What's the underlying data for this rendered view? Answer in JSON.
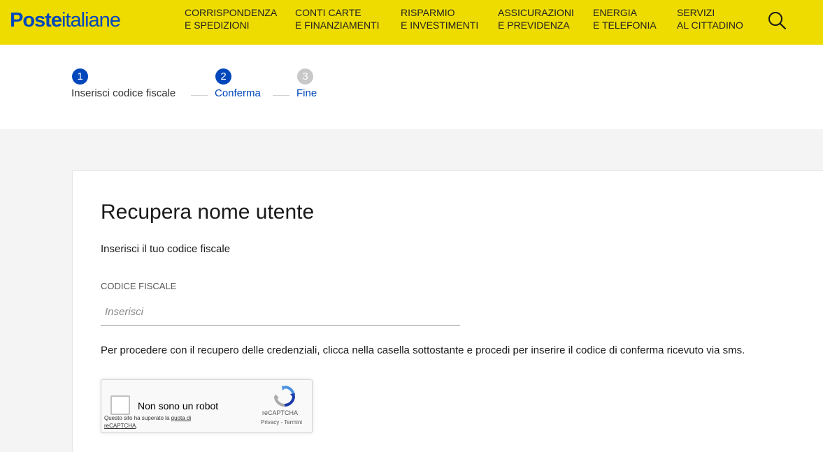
{
  "header": {
    "logo_bold": "Poste",
    "logo_light": "italiane",
    "nav": [
      {
        "line1": "CORRISPONDENZA",
        "line2": "E SPEDIZIONI"
      },
      {
        "line1": "CONTI CARTE",
        "line2": "E FINANZIAMENTI"
      },
      {
        "line1": "RISPARMIO",
        "line2": "E INVESTIMENTI"
      },
      {
        "line1": "ASSICURAZIONI",
        "line2": "E PREVIDENZA"
      },
      {
        "line1": "ENERGIA",
        "line2": "E TELEFONIA"
      },
      {
        "line1": "SERVIZI",
        "line2": "AL CITTADINO"
      }
    ],
    "search_icon": "search-icon"
  },
  "stepper": {
    "steps": [
      {
        "number": "1",
        "label": "Inserisci codice fiscale",
        "state": "completed"
      },
      {
        "number": "2",
        "label": "Conferma",
        "state": "active"
      },
      {
        "number": "3",
        "label": "Fine",
        "state": "pending"
      }
    ]
  },
  "form": {
    "title": "Recupera nome utente",
    "subtitle": "Inserisci il tuo codice fiscale",
    "field_label": "CODICE FISCALE",
    "field_placeholder": "Inserisci",
    "field_value": "",
    "instructions": "Per procedere con il recupero delle credenziali, clicca nella casella sottostante e procedi per inserire il codice di conferma ricevuto via sms."
  },
  "captcha": {
    "label": "Non sono un robot",
    "note_prefix": "Questo sito ha superato la ",
    "note_link": "quota di reCAPTCHA",
    "note_suffix": ".",
    "brand": "reCAPTCHA",
    "terms": "Privacy - Termini"
  },
  "colors": {
    "header_bg": "#eedc00",
    "brand_blue": "#0047bb",
    "step_pending": "#c8c8c8"
  }
}
